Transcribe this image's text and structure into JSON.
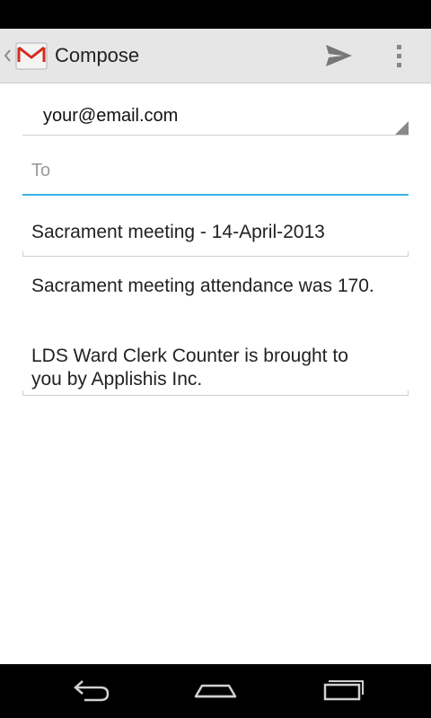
{
  "action_bar": {
    "title": "Compose",
    "app_icon": "gmail-icon",
    "send_icon": "send-icon",
    "overflow_icon": "overflow-menu-icon"
  },
  "compose": {
    "from": "your@email.com",
    "to_value": "",
    "to_placeholder": "To",
    "subject": "Sacrament meeting - 14-April-2013",
    "body_lines": [
      "Sacrament meeting attendance was 170.",
      "",
      "LDS Ward Clerk Counter is brought to",
      "you by Applishis Inc."
    ]
  },
  "nav_bar": {
    "back_icon": "back-icon",
    "home_icon": "home-icon",
    "recents_icon": "recent-apps-icon"
  },
  "colors": {
    "accent": "#33b5e5",
    "action_bar_bg": "#e6e6e6",
    "gmail_red": "#d42c20"
  }
}
